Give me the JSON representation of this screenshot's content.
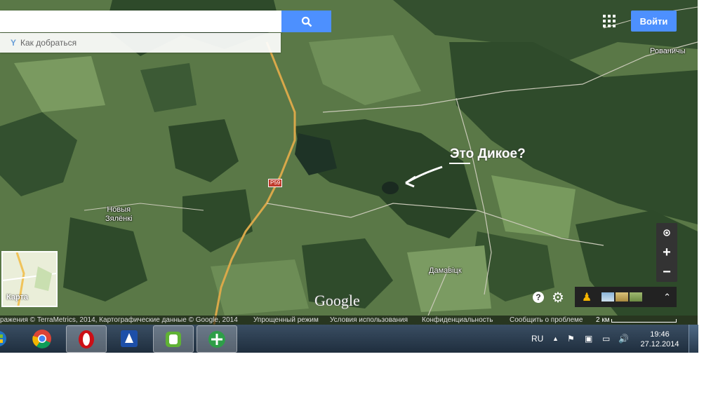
{
  "search": {
    "value": "",
    "placeholder": ""
  },
  "directions": {
    "label": "Как добраться"
  },
  "header": {
    "signin_label": "Войти"
  },
  "places": {
    "rovanichi": "Рованичы",
    "novyya_zyalenki": "Новыя\nЗялёнкі",
    "damavitsk": "Дамавіцк"
  },
  "annotation": {
    "text": "Это Дикое?"
  },
  "road": {
    "label": "P59"
  },
  "minimap": {
    "label": "Карта"
  },
  "zoom": {
    "in": "+",
    "out": "−"
  },
  "logo": "Google",
  "footer": {
    "imagery": "ражения © TerraMetrics, 2014, Картографические данные © Google, 2014",
    "lite_mode": "Упрощенный режим",
    "terms": "Условия использования",
    "privacy": "Конфиденциальность",
    "report": "Сообщить о проблеме",
    "scale": "2 км"
  },
  "taskbar": {
    "lang": "RU",
    "time": "19:46",
    "date": "27.12.2014"
  },
  "colors": {
    "accent_blue": "#4d90fe",
    "map_green": "#4f6b3e",
    "taskbar": "#2b3c50"
  },
  "icons": [
    "search-icon",
    "directions-icon",
    "apps-grid-icon",
    "my-location-icon",
    "help-icon",
    "gear-icon",
    "pegman-icon",
    "expand-icon",
    "start-icon",
    "chrome-icon",
    "opera-icon",
    "flag-icon",
    "network-icon",
    "volume-icon"
  ]
}
